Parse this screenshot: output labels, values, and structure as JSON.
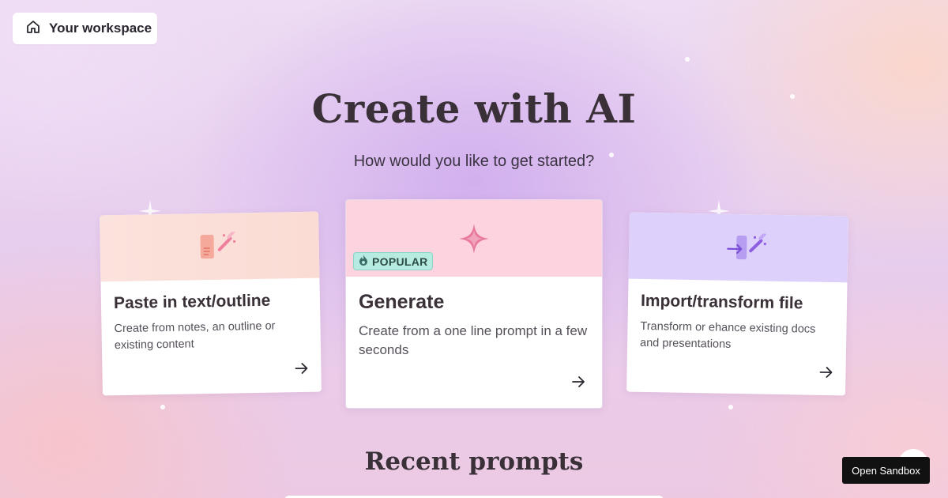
{
  "header": {
    "workspace_label": "Your workspace",
    "workspace_icon": "home-icon"
  },
  "hero": {
    "title": "Create with AI",
    "subtitle": "How would you like to get started?"
  },
  "options": [
    {
      "title": "Paste in text/outline",
      "description": "Create from notes, an outline or existing content",
      "icon": "document-wand-icon",
      "banner_color": "#fbe2dc"
    },
    {
      "title": "Generate",
      "description": "Create from a one line prompt in a few seconds",
      "icon": "sparkle-icon",
      "badge": "POPULAR",
      "badge_icon": "fire-icon",
      "banner_color": "#fdd3e0"
    },
    {
      "title": "Import/transform file",
      "description": "Transform or ehance existing docs and presentations",
      "icon": "import-wand-icon",
      "banner_color": "#ddd0fb"
    }
  ],
  "recent": {
    "title": "Recent prompts"
  },
  "footer": {
    "sandbox_label": "Open Sandbox"
  },
  "colors": {
    "accent_pink": "#e8799d",
    "accent_purple": "#8d5fe0",
    "badge_teal": "#b7ebe1"
  }
}
